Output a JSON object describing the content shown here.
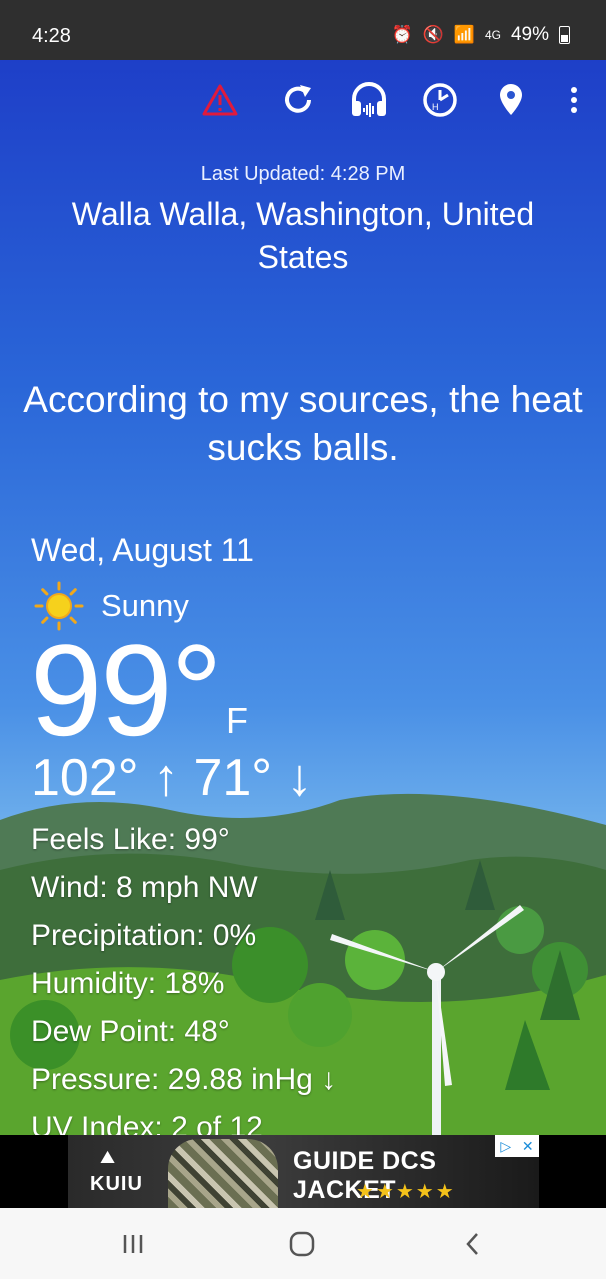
{
  "status_bar": {
    "time": "4:28",
    "battery": "49%",
    "network": "4G"
  },
  "toolbar": {
    "icons": [
      "warning-icon",
      "refresh-icon",
      "headphones-icon",
      "history-icon",
      "location-pin-icon",
      "overflow-menu-icon"
    ],
    "warning_color": "#e01a3c"
  },
  "header": {
    "last_updated": "Last Updated: 4:28 PM",
    "location": "Walla Walla, Washington, United States"
  },
  "quote": "According to my sources, the heat sucks balls.",
  "current": {
    "date": "Wed, August 11",
    "condition": "Sunny",
    "condition_icon": "sun-icon",
    "temperature": "99°",
    "unit": "F",
    "high_low": "102° ↑ 71° ↓"
  },
  "details": [
    "Feels Like: 99°",
    "Wind: 8 mph NW",
    "Precipitation: 0%",
    "Humidity: 18%",
    "Dew Point: 48°",
    "Pressure: 29.88 inHg ↓",
    "UV Index: 2 of 12"
  ],
  "ad": {
    "brand": "KUIU",
    "title": "GUIDE DCS JACKET",
    "stars": "★★★★★"
  },
  "navbar": {
    "icons": [
      "recent-apps-icon",
      "home-icon",
      "back-icon"
    ]
  }
}
